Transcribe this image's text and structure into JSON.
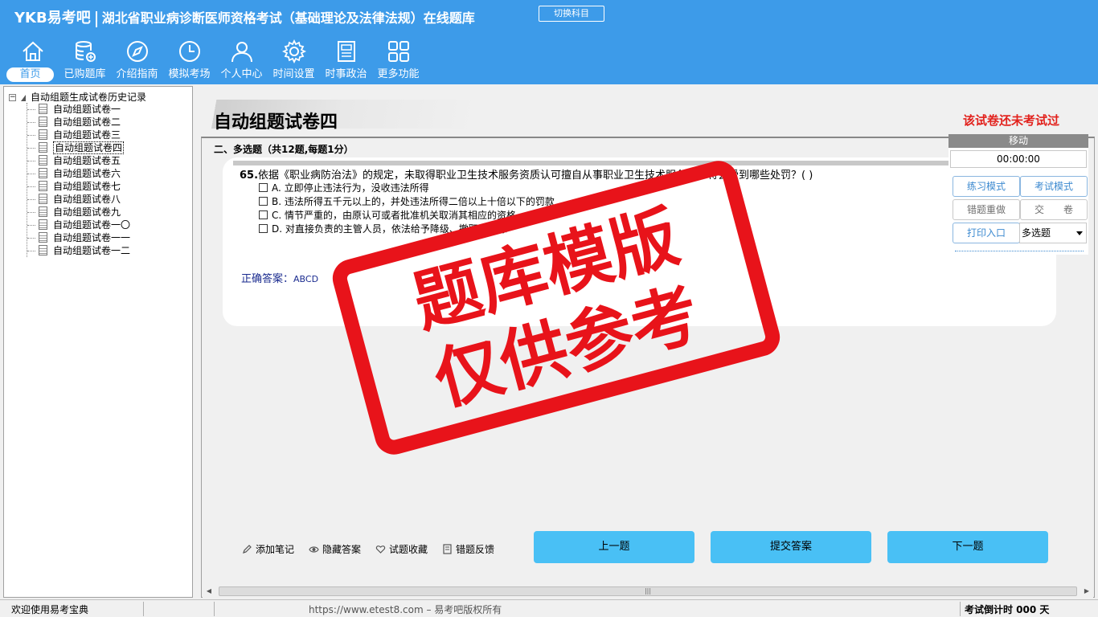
{
  "header": {
    "logo": "YKB易考吧",
    "title": "湖北省职业病诊断医师资格考试（基础理论及法律法规）在线题库",
    "switch_button": "切换科目",
    "nav": [
      {
        "label": "首页",
        "icon": "home-icon"
      },
      {
        "label": "已购题库",
        "icon": "database-icon"
      },
      {
        "label": "介绍指南",
        "icon": "compass-icon"
      },
      {
        "label": "模拟考场",
        "icon": "clock-icon"
      },
      {
        "label": "个人中心",
        "icon": "user-icon"
      },
      {
        "label": "时间设置",
        "icon": "gear-icon"
      },
      {
        "label": "时事政治",
        "icon": "news-icon"
      },
      {
        "label": "更多功能",
        "icon": "grid-icon"
      }
    ]
  },
  "sidebar": {
    "root_label": "自动组题生成试卷历史记录",
    "expander": "−",
    "items": [
      "自动组题试卷一",
      "自动组题试卷二",
      "自动组题试卷三",
      "自动组题试卷四",
      "自动组题试卷五",
      "自动组题试卷六",
      "自动组题试卷七",
      "自动组题试卷八",
      "自动组题试卷九",
      "自动组题试卷一〇",
      "自动组题试卷一一",
      "自动组题试卷一二"
    ],
    "selected_index": 3
  },
  "main": {
    "title": "自动组题试卷四",
    "status": "该试卷还未考试过",
    "section_heading": "二、多选题（共12题,每题1分）",
    "question": {
      "number": "65.",
      "text": "依据《职业病防治法》的规定，未取得职业卫生技术服务资质认可擅自从事职业卫生技术服务的，将会受到哪些处罚？( )",
      "options": [
        "A. 立即停止违法行为，没收违法所得",
        "B. 违法所得五千元以上的，并处违法所得二倍以上十倍以下的罚款",
        "C. 情节严重的，由原认可或者批准机关取消其相应的资格",
        "D. 对直接负责的主管人员，依法给予降级、撤职或开除"
      ],
      "answer_label": "正确答案：",
      "answer_value": "ABCD"
    },
    "tools": [
      {
        "label": "添加笔记",
        "icon": "pencil-icon"
      },
      {
        "label": "隐藏答案",
        "icon": "eye-icon"
      },
      {
        "label": "试题收藏",
        "icon": "heart-icon"
      },
      {
        "label": "错题反馈",
        "icon": "feedback-icon"
      }
    ],
    "buttons": {
      "prev": "上一题",
      "submit": "提交答案",
      "next": "下一题"
    }
  },
  "control_panel": {
    "move_label": "移动",
    "timer": "00:00:00",
    "practice_mode": "练习模式",
    "exam_mode": "考试模式",
    "redo_wrong": "错题重做",
    "hand_in": "交　　卷",
    "print": "打印入口",
    "question_type": "多选题"
  },
  "statusbar": {
    "welcome": "欢迎使用易考宝典",
    "copyright": "https://www.etest8.com – 易考吧版权所有",
    "countdown": "考试倒计时 000 天"
  },
  "watermark": {
    "line1": "题库模版",
    "line2": "仅供参考"
  },
  "colors": {
    "header_bg": "#3d9be9",
    "button_bg": "#49c0f5",
    "status_red": "#e2211c",
    "stamp_red": "#e8131a"
  }
}
